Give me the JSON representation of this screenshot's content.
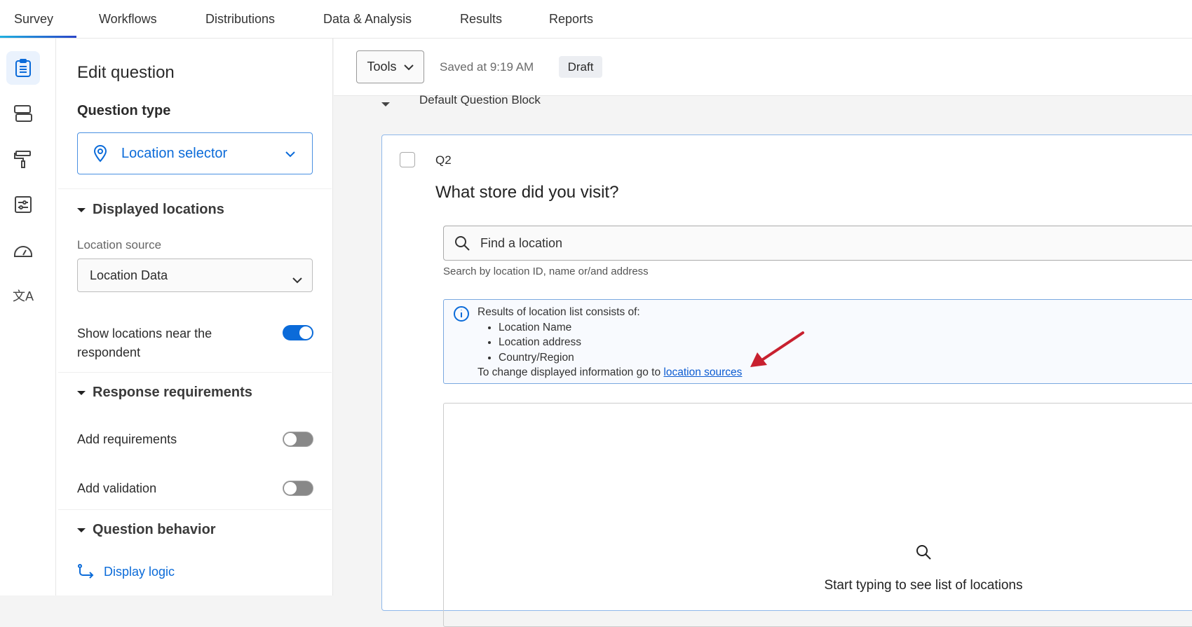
{
  "nav": {
    "tabs": [
      "Survey",
      "Workflows",
      "Distributions",
      "Data & Analysis",
      "Results",
      "Reports"
    ],
    "active": "Survey"
  },
  "rail": {
    "icons": [
      "survey-questions-icon",
      "blocks-icon",
      "look-and-feel-icon",
      "survey-options-icon",
      "survey-checker-icon",
      "translate-icon"
    ]
  },
  "panel": {
    "title": "Edit question",
    "question_type_label": "Question type",
    "question_type_value": "Location selector",
    "displayed_locations": {
      "heading": "Displayed locations",
      "source_label": "Location source",
      "source_value": "Location Data",
      "near_label": "Show locations near the respondent",
      "near_on": true
    },
    "response_requirements": {
      "heading": "Response requirements",
      "add_requirements": "Add requirements",
      "add_requirements_on": false,
      "add_validation": "Add validation",
      "add_validation_on": false
    },
    "question_behavior": {
      "heading": "Question behavior",
      "display_logic": "Display logic"
    }
  },
  "toolbar": {
    "tools": "Tools",
    "saved": "Saved at 9:19 AM",
    "status": "Draft"
  },
  "block": {
    "name": "Default Question Block"
  },
  "question": {
    "id": "Q2",
    "text": "What store did you visit?",
    "search_placeholder": "Find a location",
    "help": "Search by location ID, name or/and address",
    "info": {
      "intro": "Results of location list consists of:",
      "items": [
        "Location Name",
        "Location address",
        "Country/Region"
      ],
      "footer": "To change displayed information go to ",
      "link": "location sources"
    },
    "empty": "Start typing to see list of locations"
  },
  "colors": {
    "accent": "#0b6bd9",
    "annotation_arrow": "#c8202f"
  }
}
